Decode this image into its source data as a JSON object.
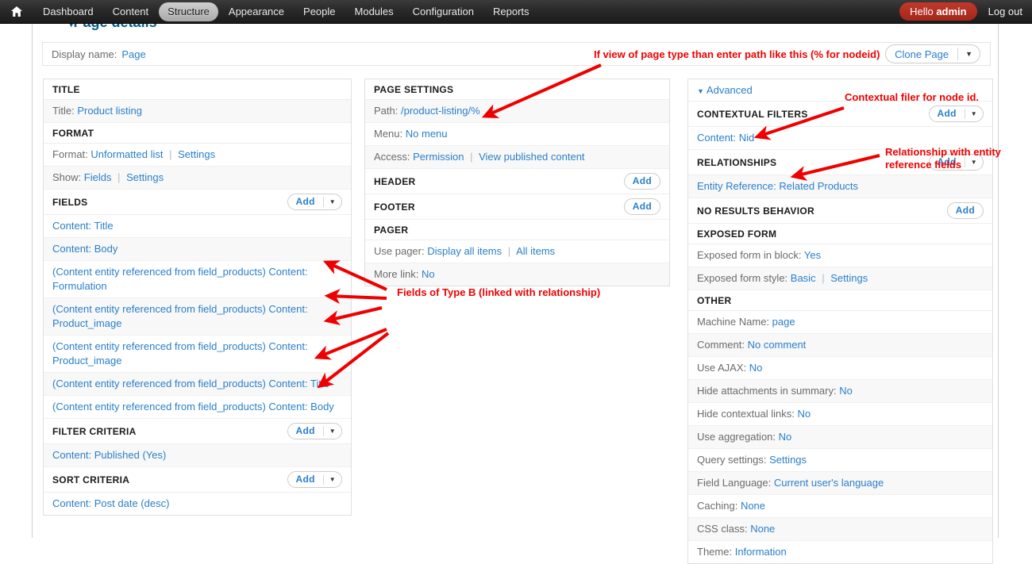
{
  "toolbar": {
    "home_icon": "home-icon",
    "items": [
      {
        "label": "Dashboard",
        "active": false
      },
      {
        "label": "Content",
        "active": false
      },
      {
        "label": "Structure",
        "active": true
      },
      {
        "label": "Appearance",
        "active": false
      },
      {
        "label": "People",
        "active": false
      },
      {
        "label": "Modules",
        "active": false
      },
      {
        "label": "Configuration",
        "active": false
      },
      {
        "label": "Reports",
        "active": false
      }
    ],
    "hello_prefix": "Hello ",
    "hello_user": "admin",
    "logout": "Log out"
  },
  "page": {
    "details_title": "Page details",
    "details_caret": "▾",
    "display_name_label": "Display name:",
    "display_name_value": "Page",
    "clone_label": "Clone Page",
    "clone_caret": "▼"
  },
  "left": {
    "title_head": "TITLE",
    "title_label": "Title:",
    "title_value": "Product listing",
    "format_head": "FORMAT",
    "format_label": "Format:",
    "format_value": "Unformatted list",
    "format_settings": "Settings",
    "show_label": "Show:",
    "show_value": "Fields",
    "show_settings": "Settings",
    "fields_head": "FIELDS",
    "fields_add": "Add",
    "fields": [
      "Content: Title",
      "Content: Body",
      "(Content entity referenced from field_products) Content: Formulation",
      "(Content entity referenced from field_products) Content: Product_image",
      "(Content entity referenced from field_products) Content: Product_image",
      "(Content entity referenced from field_products) Content: Title",
      "(Content entity referenced from field_products) Content: Body"
    ],
    "filter_head": "FILTER CRITERIA",
    "filter_add": "Add",
    "filters": [
      "Content: Published (Yes)"
    ],
    "sort_head": "SORT CRITERIA",
    "sort_add": "Add",
    "sorts": [
      "Content: Post date (desc)"
    ]
  },
  "middle": {
    "page_settings_head": "PAGE SETTINGS",
    "path_label": "Path:",
    "path_value": "/product-listing/%",
    "menu_label": "Menu:",
    "menu_value": "No menu",
    "access_label": "Access:",
    "access_value": "Permission",
    "access_value2": "View published content",
    "header_head": "HEADER",
    "header_add": "Add",
    "footer_head": "FOOTER",
    "footer_add": "Add",
    "pager_head": "PAGER",
    "use_pager_label": "Use pager:",
    "use_pager_value": "Display all items",
    "use_pager_value2": "All items",
    "more_link_label": "More link:",
    "more_link_value": "No"
  },
  "right": {
    "advanced": "Advanced",
    "advanced_caret": "▼",
    "contextual_head": "CONTEXTUAL FILTERS",
    "contextual_add": "Add",
    "contextual_items": [
      "Content: Nid"
    ],
    "relationships_head": "RELATIONSHIPS",
    "relationships_add": "Add",
    "relationships_items": [
      "Entity Reference: Related Products"
    ],
    "no_results_head": "NO RESULTS BEHAVIOR",
    "no_results_add": "Add",
    "exposed_head": "EXPOSED FORM",
    "exposed_block_label": "Exposed form in block:",
    "exposed_block_value": "Yes",
    "exposed_style_label": "Exposed form style:",
    "exposed_style_value": "Basic",
    "exposed_style_settings": "Settings",
    "other_head": "OTHER",
    "other": [
      {
        "label": "Machine Name:",
        "value": "page"
      },
      {
        "label": "Comment:",
        "value": "No comment"
      },
      {
        "label": "Use AJAX:",
        "value": "No"
      },
      {
        "label": "Hide attachments in summary:",
        "value": "No"
      },
      {
        "label": "Hide contextual links:",
        "value": "No"
      },
      {
        "label": "Use aggregation:",
        "value": "No"
      },
      {
        "label": "Query settings:",
        "value": "Settings"
      },
      {
        "label": "Field Language:",
        "value": "Current user's language"
      },
      {
        "label": "Caching:",
        "value": "None"
      },
      {
        "label": "CSS class:",
        "value": "None"
      },
      {
        "label": "Theme:",
        "value": "Information"
      }
    ]
  },
  "annotations": {
    "path": "If view of page type than enter path like this (% for nodeid)",
    "contextual": "Contextual filer for node id.",
    "relationship": "Relationship with entity reference fields",
    "fields": "Fields of Type B (linked with relationship)",
    "color": "#ef0000"
  }
}
